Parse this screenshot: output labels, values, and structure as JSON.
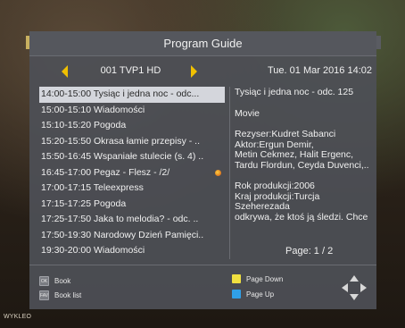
{
  "background_text": "WYKLEO",
  "header": {
    "title": "Program Guide"
  },
  "channel": {
    "name": "001 TVP1 HD"
  },
  "datetime": "Tue. 01 Mar  2016 14:02",
  "programs": [
    {
      "time": "14:00-15:00",
      "title": "Tysiąc i jedna noc - odc...",
      "selected": true
    },
    {
      "time": "15:00-15:10",
      "title": "Wiadomości"
    },
    {
      "time": "15:10-15:20",
      "title": "Pogoda"
    },
    {
      "time": "15:20-15:50",
      "title": "Okrasa łamie przepisy - .."
    },
    {
      "time": "15:50-16:45",
      "title": "Wspaniałe stulecie (s. 4) .."
    },
    {
      "time": "16:45-17:00",
      "title": "Pegaz - Flesz - /2/",
      "recording": true
    },
    {
      "time": "17:00-17:15",
      "title": "Teleexpress"
    },
    {
      "time": "17:15-17:25",
      "title": "Pogoda"
    },
    {
      "time": "17:25-17:50",
      "title": "Jaka to melodia? - odc. .."
    },
    {
      "time": "17:50-19:30",
      "title": "Narodowy Dzień Pamięci.."
    },
    {
      "time": "19:30-20:00",
      "title": "Wiadomości"
    }
  ],
  "detail": {
    "title": "Tysiąc i jedna noc - odc. 125",
    "genre": "Movie",
    "credits": [
      "Rezyser:Kudret Sabanci",
      "Aktor:Ergun Demir,",
      "Metin Cekmez, Halit Ergenc,",
      "Tardu Flordun, Ceyda Duvenci,.."
    ],
    "info": [
      "Rok produkcji:2006",
      "Kraj produkcji:Turcja",
      "Szeherezada",
      "odkrywa, że ktoś ją śledzi. Chce"
    ],
    "page": "Page:  1 / 2"
  },
  "footer": {
    "ok_key": "OK",
    "ok_label": "Book",
    "fav_key": "FAV",
    "fav_label": "Book list",
    "yellow_label": "Page Down",
    "blue_label": "Page Up"
  },
  "colors": {
    "accent_arrow": "#f0c000",
    "yellow_key": "#f0e040",
    "blue_key": "#30a0e8",
    "selected_row": "#d4d6dc"
  }
}
